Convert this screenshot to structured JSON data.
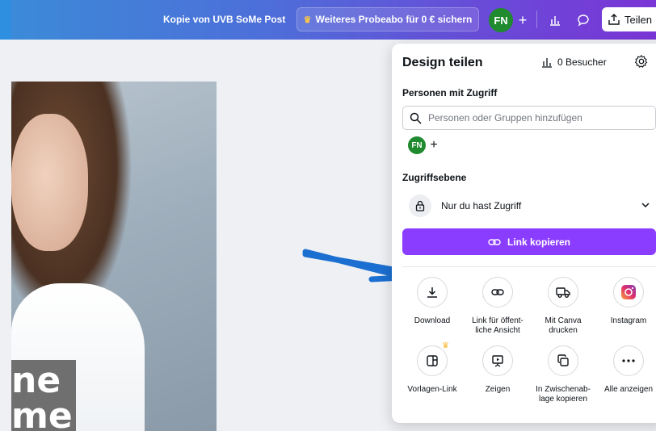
{
  "topbar": {
    "doc_title": "Kopie von UVB SoMe Post",
    "trial_label": "Weiteres Probeabo für 0 € sichern",
    "user_initials": "FN",
    "add_label": "+",
    "share_label": "Teilen"
  },
  "canvas": {
    "overlay_line1": "ne",
    "overlay_line2": "me"
  },
  "share_panel": {
    "title": "Design teilen",
    "visitors": "0 Besucher",
    "people_access_label": "Personen mit Zugriff",
    "search_placeholder": "Personen oder Gruppen hinzufügen",
    "member_initials": "FN",
    "add_member": "+",
    "access_level_label": "Zugriffsebene",
    "access_value": "Nur du hast Zugriff",
    "copy_link_label": "Link kopieren",
    "options_row1": [
      {
        "label_1": "Download",
        "label_2": "",
        "icon": "download-icon"
      },
      {
        "label_1": "Link für öffent-",
        "label_2": "liche Ansicht",
        "icon": "link-icon"
      },
      {
        "label_1": "Mit Canva",
        "label_2": "drucken",
        "icon": "truck-icon"
      },
      {
        "label_1": "Instagram",
        "label_2": "",
        "icon": "instagram-icon"
      }
    ],
    "options_row2": [
      {
        "label_1": "Vorlagen-Link",
        "label_2": "",
        "icon": "template-icon"
      },
      {
        "label_1": "Zeigen",
        "label_2": "",
        "icon": "present-icon"
      },
      {
        "label_1": "In Zwischenab-",
        "label_2": "lage kopieren",
        "icon": "clipboard-icon"
      },
      {
        "label_1": "Alle anzeigen",
        "label_2": "",
        "icon": "more-icon"
      }
    ]
  },
  "colors": {
    "accent": "#8b3dff",
    "avatar": "#1f8a2e",
    "arrow": "#1b6fd1"
  }
}
